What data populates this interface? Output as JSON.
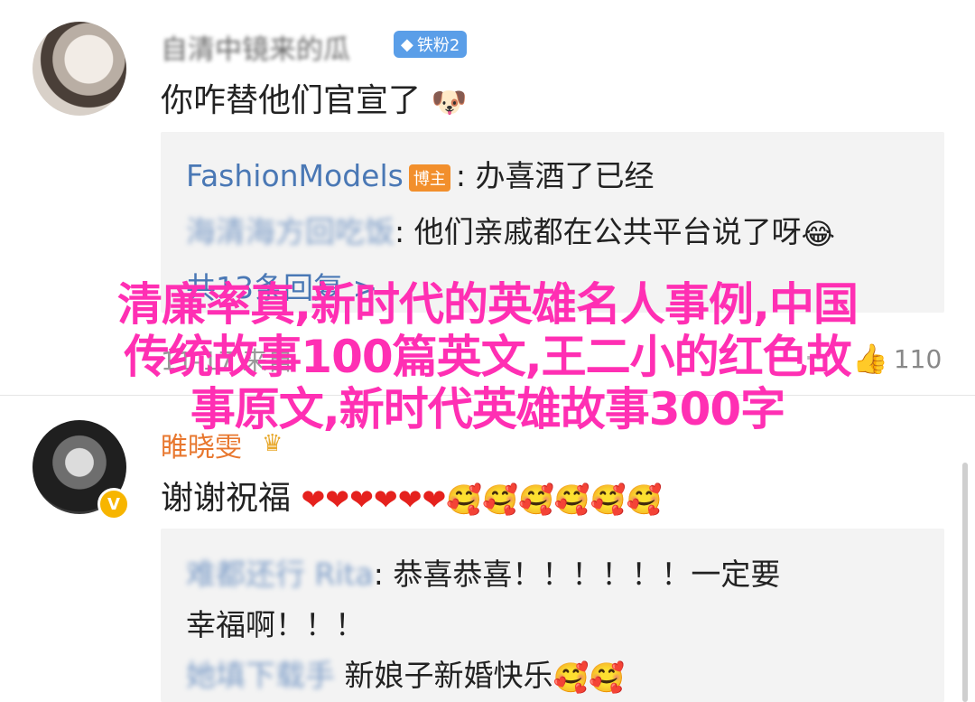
{
  "comment1": {
    "username": "自清中镜来的瓜",
    "fans_badge": "铁粉2",
    "text": "你咋替他们官宣了",
    "emoji": "🐶",
    "replies": [
      {
        "name": "FashionModels",
        "badge": "博主",
        "text": ": 办喜酒了已经",
        "emoji": ""
      },
      {
        "name": "海清海方回吃饭",
        "badge": "",
        "text": ": 他们亲戚都在公共平台说了呀",
        "emoji": "😂"
      }
    ],
    "reply_count": "共13条回复 >",
    "time": "11-17 来自",
    "likes": "110"
  },
  "comment2": {
    "username": "睢晓雯",
    "verified": "V",
    "text": "谢谢祝福",
    "emojis": "❤❤❤❤❤❤🥰🥰🥰🥰🥰🥰",
    "replies": [
      {
        "name": "难都还行 Rita",
        "text": ": 恭喜恭喜！！！！！！一定要",
        "cont": "幸福啊！！！"
      },
      {
        "name": "她填下载手",
        "text": "新娘子新婚快乐",
        "emoji": "🥰🥰"
      }
    ]
  },
  "overlay": {
    "line1": "清廉率真,新时代的英雄名人事例,中国",
    "line2": "传统故事100篇英文,王二小的红色故",
    "line3": "事原文,新时代英雄故事300字"
  },
  "colors": {
    "accent": "#ff2fb3",
    "link": "#4a78b5",
    "badge": "#5a9ee8"
  }
}
